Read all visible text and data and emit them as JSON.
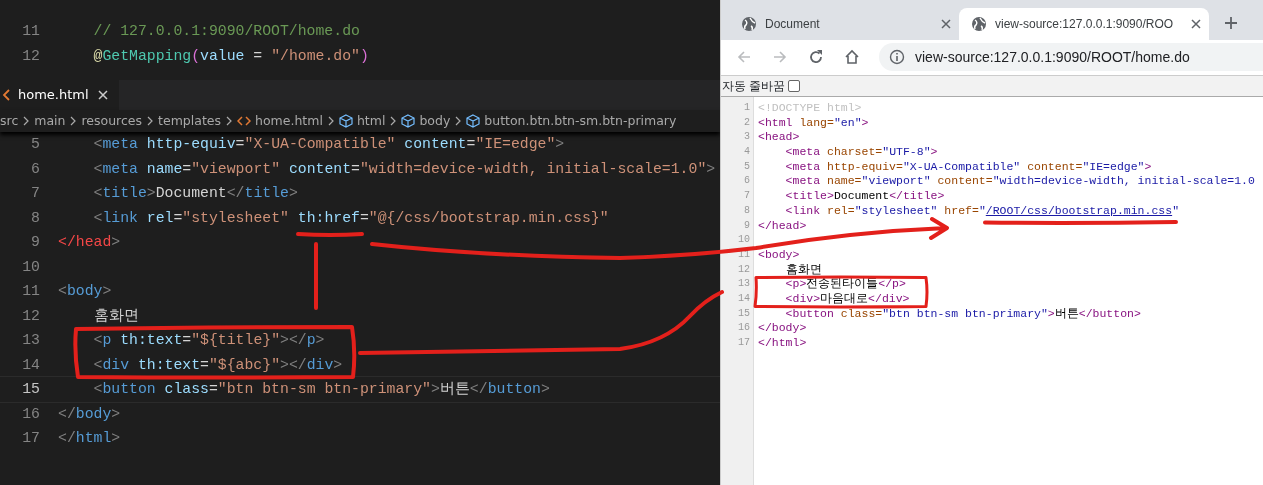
{
  "editor": {
    "java_lines": [
      {
        "number": "11",
        "indented": true,
        "tokens": [
          {
            "kind": "comment",
            "text": "// 127.0.0.1:9090/ROOT/home.do"
          }
        ]
      },
      {
        "number": "12",
        "indented": true,
        "tokens": [
          {
            "kind": "decorator",
            "text": "@"
          },
          {
            "kind": "type",
            "text": "GetMapping"
          },
          {
            "kind": "paren",
            "text": "("
          },
          {
            "kind": "attr",
            "text": "value"
          },
          {
            "kind": "text",
            "text": " = "
          },
          {
            "kind": "string",
            "text": "\"/home.do\""
          },
          {
            "kind": "paren",
            "text": ")"
          }
        ]
      }
    ],
    "tab": {
      "label": "home.html",
      "selected": true
    },
    "breadcrumbs": [
      {
        "label": "src",
        "kind": "folder"
      },
      {
        "label": "main",
        "kind": "folder"
      },
      {
        "label": "resources",
        "kind": "folder"
      },
      {
        "label": "templates",
        "kind": "folder"
      },
      {
        "label": "home.html",
        "kind": "file"
      },
      {
        "label": "html",
        "kind": "element"
      },
      {
        "label": "body",
        "kind": "element"
      },
      {
        "label": "button.btn.btn-sm.btn-primary",
        "kind": "element"
      }
    ],
    "lines": [
      {
        "number": "5",
        "current": false,
        "indented": true,
        "tokens": [
          {
            "kind": "punct",
            "text": "<"
          },
          {
            "kind": "tag",
            "text": "meta"
          },
          {
            "kind": "attr",
            "text": " http-equiv"
          },
          {
            "kind": "text",
            "text": "="
          },
          {
            "kind": "string",
            "text": "\"X-UA-Compatible\""
          },
          {
            "kind": "attr",
            "text": " content"
          },
          {
            "kind": "text",
            "text": "="
          },
          {
            "kind": "string",
            "text": "\"IE=edge\""
          },
          {
            "kind": "punct",
            "text": ">"
          }
        ]
      },
      {
        "number": "6",
        "current": false,
        "indented": true,
        "tokens": [
          {
            "kind": "punct",
            "text": "<"
          },
          {
            "kind": "tag",
            "text": "meta"
          },
          {
            "kind": "attr",
            "text": " name"
          },
          {
            "kind": "text",
            "text": "="
          },
          {
            "kind": "string",
            "text": "\"viewport\""
          },
          {
            "kind": "attr",
            "text": " content"
          },
          {
            "kind": "text",
            "text": "="
          },
          {
            "kind": "string",
            "text": "\"width=device-width, initial-scale=1.0\""
          },
          {
            "kind": "punct",
            "text": ">"
          }
        ]
      },
      {
        "number": "7",
        "current": false,
        "indented": true,
        "tokens": [
          {
            "kind": "punct",
            "text": "<"
          },
          {
            "kind": "tag",
            "text": "title"
          },
          {
            "kind": "punct",
            "text": ">"
          },
          {
            "kind": "text",
            "text": "Document"
          },
          {
            "kind": "punct",
            "text": "</"
          },
          {
            "kind": "tag",
            "text": "title"
          },
          {
            "kind": "punct",
            "text": ">"
          }
        ]
      },
      {
        "number": "8",
        "current": false,
        "indented": true,
        "tokens": [
          {
            "kind": "punct",
            "text": "<"
          },
          {
            "kind": "tag",
            "text": "link"
          },
          {
            "kind": "attr",
            "text": " rel"
          },
          {
            "kind": "text",
            "text": "="
          },
          {
            "kind": "string",
            "text": "\"stylesheet\""
          },
          {
            "kind": "attr",
            "text": " th:href"
          },
          {
            "kind": "text",
            "text": "="
          },
          {
            "kind": "string",
            "text": "\"@{/css/bootstrap.min.css}\""
          }
        ]
      },
      {
        "number": "9",
        "current": false,
        "indented": false,
        "tokens": [
          {
            "kind": "error",
            "text": "</head"
          },
          {
            "kind": "punct",
            "text": ">"
          }
        ]
      },
      {
        "number": "10",
        "current": false
      },
      {
        "number": "11",
        "current": false,
        "indented": false,
        "tokens": [
          {
            "kind": "punct",
            "text": "<"
          },
          {
            "kind": "tag",
            "text": "body"
          },
          {
            "kind": "punct",
            "text": ">"
          }
        ]
      },
      {
        "number": "12",
        "current": false,
        "indented": true,
        "tokens": [
          {
            "kind": "text",
            "text": "홈화면"
          }
        ]
      },
      {
        "number": "13",
        "current": false,
        "indented": true,
        "tokens": [
          {
            "kind": "punct",
            "text": "<"
          },
          {
            "kind": "tag",
            "text": "p"
          },
          {
            "kind": "attr",
            "text": " th:text"
          },
          {
            "kind": "text",
            "text": "="
          },
          {
            "kind": "string",
            "text": "\"${title}\""
          },
          {
            "kind": "punct",
            "text": "></"
          },
          {
            "kind": "tag",
            "text": "p"
          },
          {
            "kind": "punct",
            "text": ">"
          }
        ]
      },
      {
        "number": "14",
        "current": false,
        "indented": true,
        "tokens": [
          {
            "kind": "punct",
            "text": "<"
          },
          {
            "kind": "tag",
            "text": "div"
          },
          {
            "kind": "attr",
            "text": " th:text"
          },
          {
            "kind": "text",
            "text": "="
          },
          {
            "kind": "string",
            "text": "\"${abc}\""
          },
          {
            "kind": "punct",
            "text": "></"
          },
          {
            "kind": "tag",
            "text": "div"
          },
          {
            "kind": "punct",
            "text": ">"
          }
        ]
      },
      {
        "number": "15",
        "current": true,
        "indented": true,
        "tokens": [
          {
            "kind": "punct",
            "text": "<"
          },
          {
            "kind": "tag",
            "text": "button"
          },
          {
            "kind": "attr",
            "text": " class"
          },
          {
            "kind": "text",
            "text": "="
          },
          {
            "kind": "string",
            "text": "\"btn btn-sm btn-primary\""
          },
          {
            "kind": "punct",
            "text": ">"
          },
          {
            "kind": "text",
            "text": "버튼"
          },
          {
            "kind": "punct",
            "text": "</"
          },
          {
            "kind": "tag",
            "text": "button"
          },
          {
            "kind": "punct",
            "text": ">"
          }
        ]
      },
      {
        "number": "16",
        "current": false,
        "indented": false,
        "tokens": [
          {
            "kind": "punct",
            "text": "</"
          },
          {
            "kind": "tag",
            "text": "body"
          },
          {
            "kind": "punct",
            "text": ">"
          }
        ]
      },
      {
        "number": "17",
        "current": false,
        "indented": false,
        "tokens": [
          {
            "kind": "punct",
            "text": "</"
          },
          {
            "kind": "tag",
            "text": "html"
          },
          {
            "kind": "punct",
            "text": ">"
          }
        ]
      }
    ]
  },
  "browser": {
    "tabs": [
      {
        "label": "Document",
        "selected": false
      },
      {
        "label": "view-source:127.0.0.1:9090/ROO",
        "selected": true
      }
    ],
    "address": "view-source:127.0.0.1:9090/ROOT/home.do",
    "wrap_option": {
      "label": "자동 줄바꿈",
      "checked": false
    },
    "source_lines": [
      {
        "number": "1",
        "indented": false,
        "tokens": [
          {
            "kind": "doctype",
            "text": "<!DOCTYPE html>"
          }
        ]
      },
      {
        "number": "2",
        "indented": false,
        "tokens": [
          {
            "kind": "tag",
            "text": "<html"
          },
          {
            "kind": "attr",
            "text": " lang="
          },
          {
            "kind": "value",
            "text": "\"en\""
          },
          {
            "kind": "tag",
            "text": ">"
          }
        ]
      },
      {
        "number": "3",
        "indented": false,
        "tokens": [
          {
            "kind": "tag",
            "text": "<head>"
          }
        ]
      },
      {
        "number": "4",
        "indented": true,
        "tokens": [
          {
            "kind": "tag",
            "text": "<meta"
          },
          {
            "kind": "attr",
            "text": " charset="
          },
          {
            "kind": "value",
            "text": "\"UTF-8\""
          },
          {
            "kind": "tag",
            "text": ">"
          }
        ]
      },
      {
        "number": "5",
        "indented": true,
        "tokens": [
          {
            "kind": "tag",
            "text": "<meta"
          },
          {
            "kind": "attr",
            "text": " http-equiv="
          },
          {
            "kind": "value",
            "text": "\"X-UA-Compatible\""
          },
          {
            "kind": "attr",
            "text": " content="
          },
          {
            "kind": "value",
            "text": "\"IE=edge\""
          },
          {
            "kind": "tag",
            "text": ">"
          }
        ]
      },
      {
        "number": "6",
        "indented": true,
        "tokens": [
          {
            "kind": "tag",
            "text": "<meta"
          },
          {
            "kind": "attr",
            "text": " name="
          },
          {
            "kind": "value",
            "text": "\"viewport\""
          },
          {
            "kind": "attr",
            "text": " content="
          },
          {
            "kind": "value",
            "text": "\"width=device-width, initial-scale=1.0"
          }
        ]
      },
      {
        "number": "7",
        "indented": true,
        "tokens": [
          {
            "kind": "tag",
            "text": "<title>"
          },
          {
            "kind": "text",
            "text": "Document"
          },
          {
            "kind": "tag",
            "text": "</title>"
          }
        ]
      },
      {
        "number": "8",
        "indented": true,
        "tokens": [
          {
            "kind": "tag",
            "text": "<link"
          },
          {
            "kind": "attr",
            "text": " rel="
          },
          {
            "kind": "value",
            "text": "\"stylesheet\""
          },
          {
            "kind": "attr",
            "text": " href="
          },
          {
            "kind": "value",
            "text": "\""
          },
          {
            "kind": "link",
            "text": "/ROOT/css/bootstrap.min.css"
          },
          {
            "kind": "value",
            "text": "\""
          }
        ]
      },
      {
        "number": "9",
        "indented": false,
        "tokens": [
          {
            "kind": "tag",
            "text": "</head>"
          }
        ]
      },
      {
        "number": "10"
      },
      {
        "number": "11",
        "indented": false,
        "tokens": [
          {
            "kind": "tag",
            "text": "<body>"
          }
        ]
      },
      {
        "number": "12",
        "indented": true,
        "tokens": [
          {
            "kind": "text",
            "text": "홈화면"
          }
        ]
      },
      {
        "number": "13",
        "indented": true,
        "tokens": [
          {
            "kind": "tag",
            "text": "<p>"
          },
          {
            "kind": "text",
            "text": "전송된타이틀"
          },
          {
            "kind": "tag",
            "text": "</p>"
          }
        ]
      },
      {
        "number": "14",
        "indented": true,
        "tokens": [
          {
            "kind": "tag",
            "text": "<div>"
          },
          {
            "kind": "text",
            "text": "마음대로"
          },
          {
            "kind": "tag",
            "text": "</div>"
          }
        ]
      },
      {
        "number": "15",
        "indented": true,
        "tokens": [
          {
            "kind": "tag",
            "text": "<button"
          },
          {
            "kind": "attr",
            "text": " class="
          },
          {
            "kind": "value",
            "text": "\"btn btn-sm btn-primary\""
          },
          {
            "kind": "tag",
            "text": ">"
          },
          {
            "kind": "text",
            "text": "버튼"
          },
          {
            "kind": "tag",
            "text": "</button>"
          }
        ]
      },
      {
        "number": "16",
        "indented": false,
        "tokens": [
          {
            "kind": "tag",
            "text": "</body>"
          }
        ]
      },
      {
        "number": "17",
        "indented": false,
        "tokens": [
          {
            "kind": "tag",
            "text": "</html>"
          }
        ]
      }
    ]
  }
}
